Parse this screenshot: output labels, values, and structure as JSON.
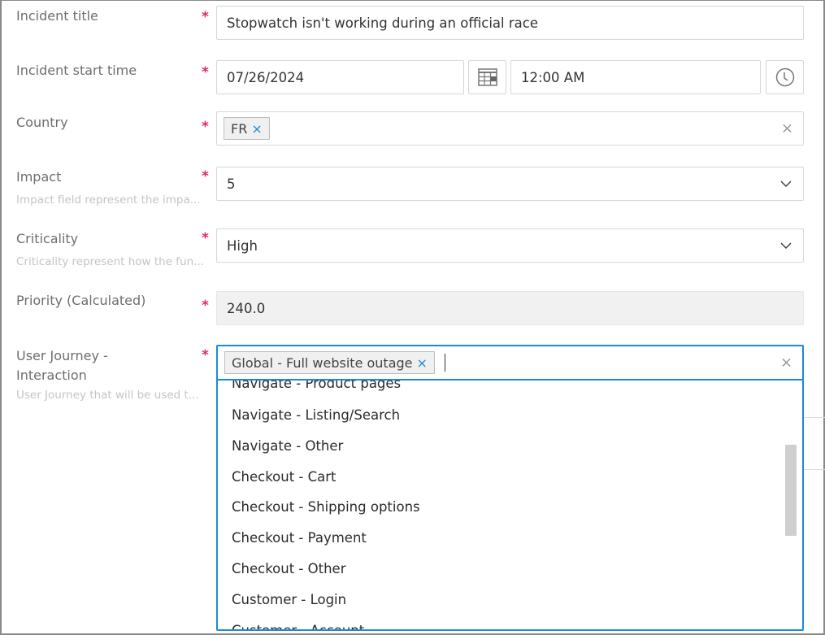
{
  "form": {
    "required_mark": "*",
    "incident_title": {
      "label": "Incident title",
      "value": "Stopwatch isn't working during an official race"
    },
    "incident_start_time": {
      "label": "Incident start time",
      "date_value": "07/26/2024",
      "time_value": "12:00 AM",
      "calendar_icon": "calendar-icon",
      "clock_icon": "clock-icon"
    },
    "country": {
      "label": "Country",
      "chips": [
        {
          "label": "FR",
          "remove": "×"
        }
      ],
      "clear": "×"
    },
    "impact": {
      "label": "Impact",
      "hint": "Impact field represent the impa...",
      "value": "5"
    },
    "criticality": {
      "label": "Criticality",
      "hint": "Criticality represent how the fun...",
      "value": "High"
    },
    "priority": {
      "label": "Priority (Calculated)",
      "value": "240.0"
    },
    "user_journey": {
      "label_line1": "User Journey -",
      "label_line2": "Interaction",
      "hint": "User Journey that will be used t...",
      "chips": [
        {
          "label": "Global - Full website outage",
          "remove": "×"
        }
      ],
      "clear": "×",
      "options": [
        "Navigate - Product pages",
        "Navigate - Listing/Search",
        "Navigate - Other",
        "Checkout - Cart",
        "Checkout - Shipping options",
        "Checkout - Payment",
        "Checkout - Other",
        "Customer - Login",
        "Customer - Account"
      ]
    }
  },
  "colors": {
    "accent": "#1c8ad8",
    "required": "#e3266b",
    "readonly_bg": "#f1f1f1"
  }
}
